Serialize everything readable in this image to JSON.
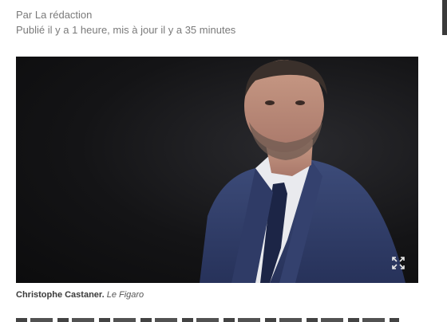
{
  "article": {
    "byline": "Par La rédaction",
    "published": "Publié il y a 1 heure, mis à jour il y a 35 minutes"
  },
  "photo": {
    "expand_icon": "expand-icon"
  },
  "caption": {
    "name": "Christophe Castaner.",
    "credit": "Le Figaro"
  }
}
